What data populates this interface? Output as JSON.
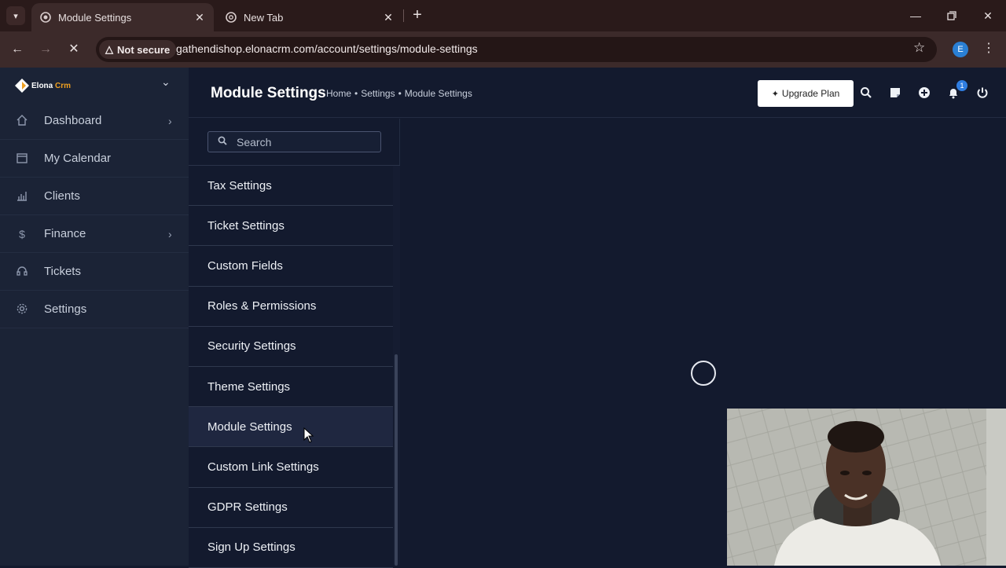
{
  "browser": {
    "tabs": [
      {
        "title": "Module Settings",
        "active": true
      },
      {
        "title": "New Tab",
        "active": false
      }
    ],
    "security_label": "Not secure",
    "url": "gathendishop.elonacrm.com/account/settings/module-settings",
    "profile_initial": "E"
  },
  "brand": {
    "name": "Elona",
    "name_accent": "Crm"
  },
  "sidebar": {
    "items": [
      {
        "label": "Dashboard",
        "icon": "home-icon",
        "has_submenu": true
      },
      {
        "label": "My Calendar",
        "icon": "calendar-icon",
        "has_submenu": false
      },
      {
        "label": "Clients",
        "icon": "chart-bar-icon",
        "has_submenu": false
      },
      {
        "label": "Finance",
        "icon": "dollar-icon",
        "has_submenu": true
      },
      {
        "label": "Tickets",
        "icon": "headset-icon",
        "has_submenu": false
      },
      {
        "label": "Settings",
        "icon": "gear-icon",
        "has_submenu": false
      }
    ]
  },
  "header": {
    "title": "Module Settings",
    "breadcrumb": [
      "Home",
      "Settings",
      "Module Settings"
    ],
    "upgrade_label": "Upgrade Plan",
    "notification_count": "1"
  },
  "settings_menu": {
    "search_placeholder": "Search",
    "items": [
      "Tax Settings",
      "Ticket Settings",
      "Custom Fields",
      "Roles & Permissions",
      "Security Settings",
      "Theme Settings",
      "Module Settings",
      "Custom Link Settings",
      "GDPR Settings",
      "Sign Up Settings"
    ],
    "active_item": "Module Settings"
  },
  "colors": {
    "sidebar_bg": "#1b2336",
    "main_bg": "#131a2e",
    "browser_frame": "#2a1a1a",
    "notification_badge": "#2f7de1"
  }
}
